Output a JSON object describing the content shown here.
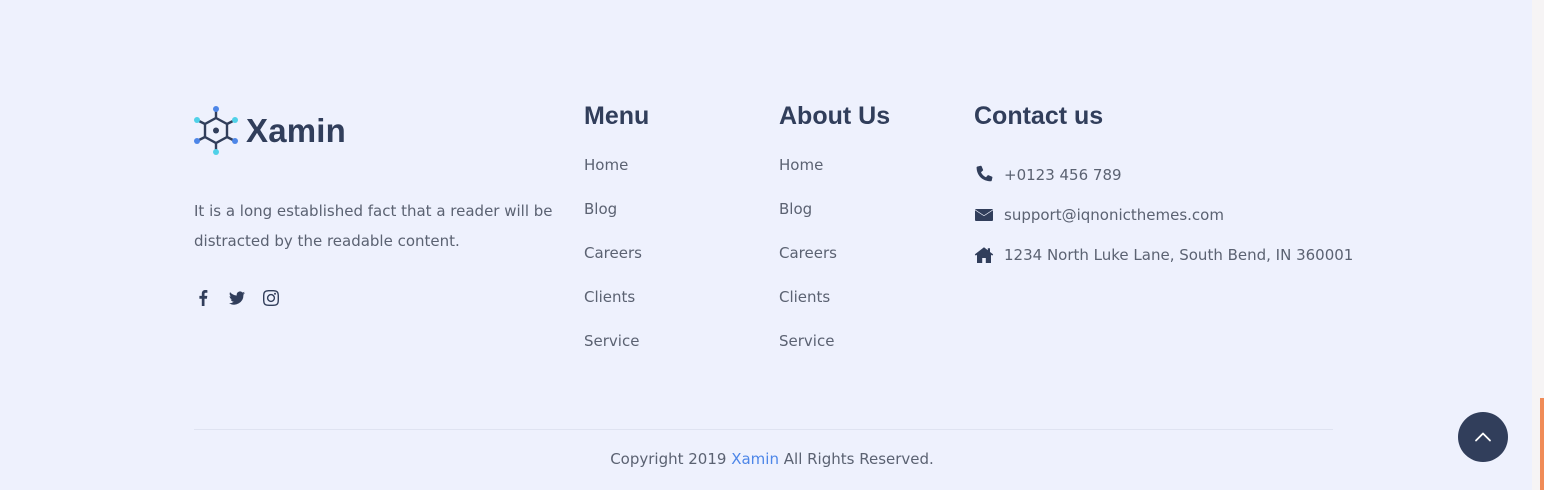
{
  "brand": {
    "name": "Xamin",
    "description": "It is a long established fact that a reader will be distracted by the readable content."
  },
  "socials": [
    {
      "icon": "facebook-icon"
    },
    {
      "icon": "twitter-icon"
    },
    {
      "icon": "instagram-icon"
    }
  ],
  "menu": {
    "title": "Menu",
    "items": [
      "Home",
      "Blog",
      "Careers",
      "Clients",
      "Service"
    ]
  },
  "about": {
    "title": "About Us",
    "items": [
      "Home",
      "Blog",
      "Careers",
      "Clients",
      "Service"
    ]
  },
  "contact": {
    "title": "Contact us",
    "phone": "+0123 456 789",
    "email": "support@iqnonicthemes.com",
    "address": "1234 North Luke Lane, South Bend, IN 360001"
  },
  "footer": {
    "copyright_prefix": "Copyright 2019",
    "brand_link": "Xamin",
    "copyright_suffix": "All Rights Reserved."
  },
  "colors": {
    "background": "#eef1fd",
    "heading": "#313e5b",
    "text": "#5b6272",
    "link_accent": "#4d86e8",
    "scroll_accent": "#f08b57"
  }
}
